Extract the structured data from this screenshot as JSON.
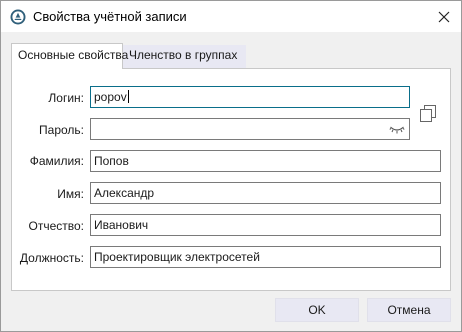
{
  "window": {
    "title": "Свойства учётной записи",
    "icons": {
      "app": "app-logo-icon",
      "close": "close-icon"
    }
  },
  "tabs": [
    {
      "label": "Основные свойства",
      "active": true
    },
    {
      "label": "Членство в группах",
      "active": false
    }
  ],
  "form": {
    "login": {
      "label": "Логин:",
      "value": "popov"
    },
    "password": {
      "label": "Пароль:",
      "value": "",
      "icon": "eye-closed-icon"
    },
    "lastname": {
      "label": "Фамилия:",
      "value": "Попов"
    },
    "firstname": {
      "label": "Имя:",
      "value": "Александр"
    },
    "middlename": {
      "label": "Отчество:",
      "value": "Иванович"
    },
    "position": {
      "label": "Должность:",
      "value": "Проектировщик электросетей"
    },
    "copy_icon": "copy-icon"
  },
  "buttons": {
    "ok": "OK",
    "cancel": "Отмена"
  },
  "colors": {
    "accent": "#0a6e8a",
    "button_bg": "#e8e8f3",
    "window_bg": "#f0f0f0"
  }
}
